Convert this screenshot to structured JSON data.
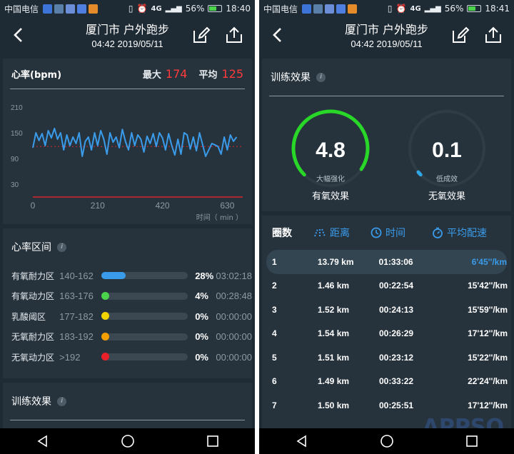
{
  "status": {
    "carrier": "中国电信",
    "network": "4G",
    "battery": "56%",
    "time_left": "18:40",
    "time_right": "18:41"
  },
  "header": {
    "title": "厦门市 户外跑步",
    "subtitle": "04:42 2019/05/11"
  },
  "heart_rate": {
    "label": "心率(bpm)",
    "max_label": "最大",
    "max_value": "174",
    "avg_label": "平均",
    "avg_value": "125",
    "x_unit_label": "时间（ min ）"
  },
  "chart_data": {
    "type": "line",
    "title": "心率(bpm)",
    "xlabel": "时间（ min ）",
    "ylabel": "",
    "x_ticks": [
      0,
      210,
      420,
      630
    ],
    "y_ticks": [
      210,
      150,
      90,
      30
    ],
    "xlim": [
      0,
      680
    ],
    "ylim": [
      0,
      240
    ],
    "avg_line": 118,
    "series": [
      {
        "x": [
          0,
          10,
          20,
          30,
          40,
          50,
          60,
          70,
          80,
          90,
          100,
          110,
          120,
          130,
          140,
          150,
          160,
          170,
          180,
          190,
          200,
          210,
          220,
          230,
          240,
          250,
          260,
          270,
          280,
          290,
          300,
          310,
          320,
          330,
          340,
          350,
          360,
          370,
          380,
          390,
          400,
          410,
          420,
          430,
          440,
          450,
          460,
          470,
          480,
          490,
          500,
          510,
          520,
          530,
          540,
          560,
          580,
          600,
          610,
          620,
          630,
          640,
          650,
          660
        ],
        "y": [
          115,
          150,
          132,
          148,
          120,
          155,
          138,
          160,
          135,
          150,
          110,
          145,
          120,
          140,
          125,
          150,
          95,
          130,
          140,
          110,
          150,
          120,
          155,
          135,
          100,
          150,
          128,
          140,
          115,
          158,
          130,
          110,
          150,
          120,
          145,
          135,
          105,
          142,
          125,
          148,
          118,
          150,
          138,
          110,
          148,
          120,
          98,
          135,
          100,
          150,
          145,
          112,
          140,
          108,
          150,
          95,
          125,
          118,
          100,
          140,
          110,
          145,
          130,
          140
        ]
      }
    ]
  },
  "zones": {
    "title": "心率区间",
    "items": [
      {
        "name": "有氧耐力区",
        "range": "140-162",
        "pct": "28%",
        "time": "03:02:18",
        "fraction": 0.28,
        "color": "#3a9bea"
      },
      {
        "name": "有氧动力区",
        "range": "163-176",
        "pct": "4%",
        "time": "00:28:48",
        "fraction": 0.04,
        "color": "#4bd44b"
      },
      {
        "name": "乳酸阈区",
        "range": "177-182",
        "pct": "0%",
        "time": "00:00:00",
        "fraction": 0,
        "color": "#f2d500"
      },
      {
        "name": "无氧耐力区",
        "range": "183-192",
        "pct": "0%",
        "time": "00:00:00",
        "fraction": 0,
        "color": "#f5a000"
      },
      {
        "name": "无氧动力区",
        "range": ">192",
        "pct": "0%",
        "time": "00:00:00",
        "fraction": 0,
        "color": "#e8202a"
      }
    ]
  },
  "training": {
    "title": "训练效果",
    "aerobic": {
      "value": "4.8",
      "sub": "大幅强化",
      "label": "有氧效果",
      "fraction": 0.96
    },
    "anaerobic": {
      "value": "0.1",
      "sub": "低成效",
      "label": "无氧效果",
      "fraction": 0.02
    }
  },
  "laps": {
    "headers": {
      "lap": "圈数",
      "distance": "距离",
      "time": "时间",
      "pace": "平均配速"
    },
    "rows": [
      {
        "lap": "1",
        "distance": "13.79 km",
        "time": "01:33:06",
        "pace": "6'45''/km"
      },
      {
        "lap": "2",
        "distance": "1.46 km",
        "time": "00:22:54",
        "pace": "15'42''/km"
      },
      {
        "lap": "3",
        "distance": "1.52 km",
        "time": "00:24:13",
        "pace": "15'59''/km"
      },
      {
        "lap": "4",
        "distance": "1.54 km",
        "time": "00:26:29",
        "pace": "17'12''/km"
      },
      {
        "lap": "5",
        "distance": "1.51 km",
        "time": "00:23:12",
        "pace": "15'22''/km"
      },
      {
        "lap": "6",
        "distance": "1.49 km",
        "time": "00:33:22",
        "pace": "22'24''/km"
      },
      {
        "lap": "7",
        "distance": "1.50 km",
        "time": "00:25:51",
        "pace": "17'12''/km"
      }
    ]
  },
  "watermark": "APPSO"
}
